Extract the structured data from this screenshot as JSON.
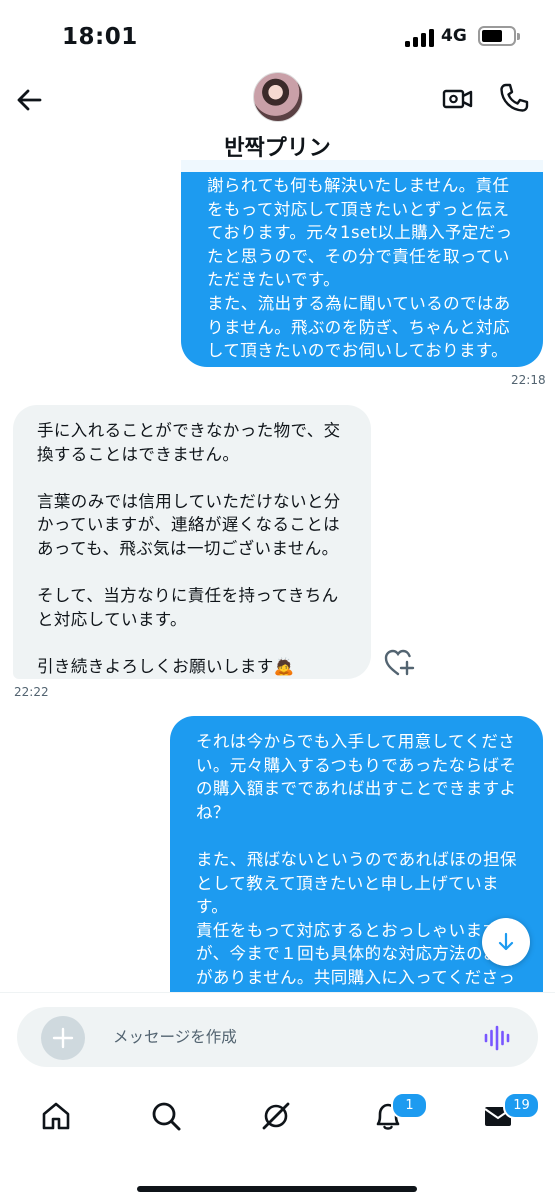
{
  "status_bar": {
    "time": "18:01",
    "network": "4G"
  },
  "header": {
    "name": "반짝プリン"
  },
  "messages": [
    {
      "direction": "out",
      "text": "謝られても何も解決いたしません。責任をもって対応して頂きたいとずっと伝えております。元々1set以上購入予定だったと思うので、その分で責任を取っていただきたいです。\nまた、流出する為に聞いているのではありません。飛ぶのを防ぎ、ちゃんと対応して頂きたいのでお伺いしております。",
      "time": "22:18"
    },
    {
      "direction": "in",
      "text": "手に入れることができなかった物で、交換することはできません。\n\n言葉のみでは信用していただけないと分かっていますが、連絡が遅くなることはあっても、飛ぶ気は一切ございません。\n\nそして、当方なりに責任を持ってきちんと対応しています。\n\n引き続きよろしくお願いします🙇",
      "time": "22:22"
    },
    {
      "direction": "out",
      "text": "それは今からでも入手して用意してください。元々購入するつもりであったならばその購入額までであれば出すことできますよね？\n\nまた、飛ばないというのであればほの担保として教えて頂きたいと申し上げています。\n責任をもって対応するとおっしゃいますが、今まで１回も具体的な対応方法のお話がありません。共同購入に入ってくださっている方もいらっしゃるのでこれ以上"
    }
  ],
  "composer": {
    "placeholder": "メッセージを作成"
  },
  "tabbar": {
    "notifications_badge": "1",
    "messages_badge": "19"
  },
  "colors": {
    "accent": "#1d9bf0",
    "incoming_bubble": "#eff3f4",
    "voice_icon": "#7856ff"
  }
}
